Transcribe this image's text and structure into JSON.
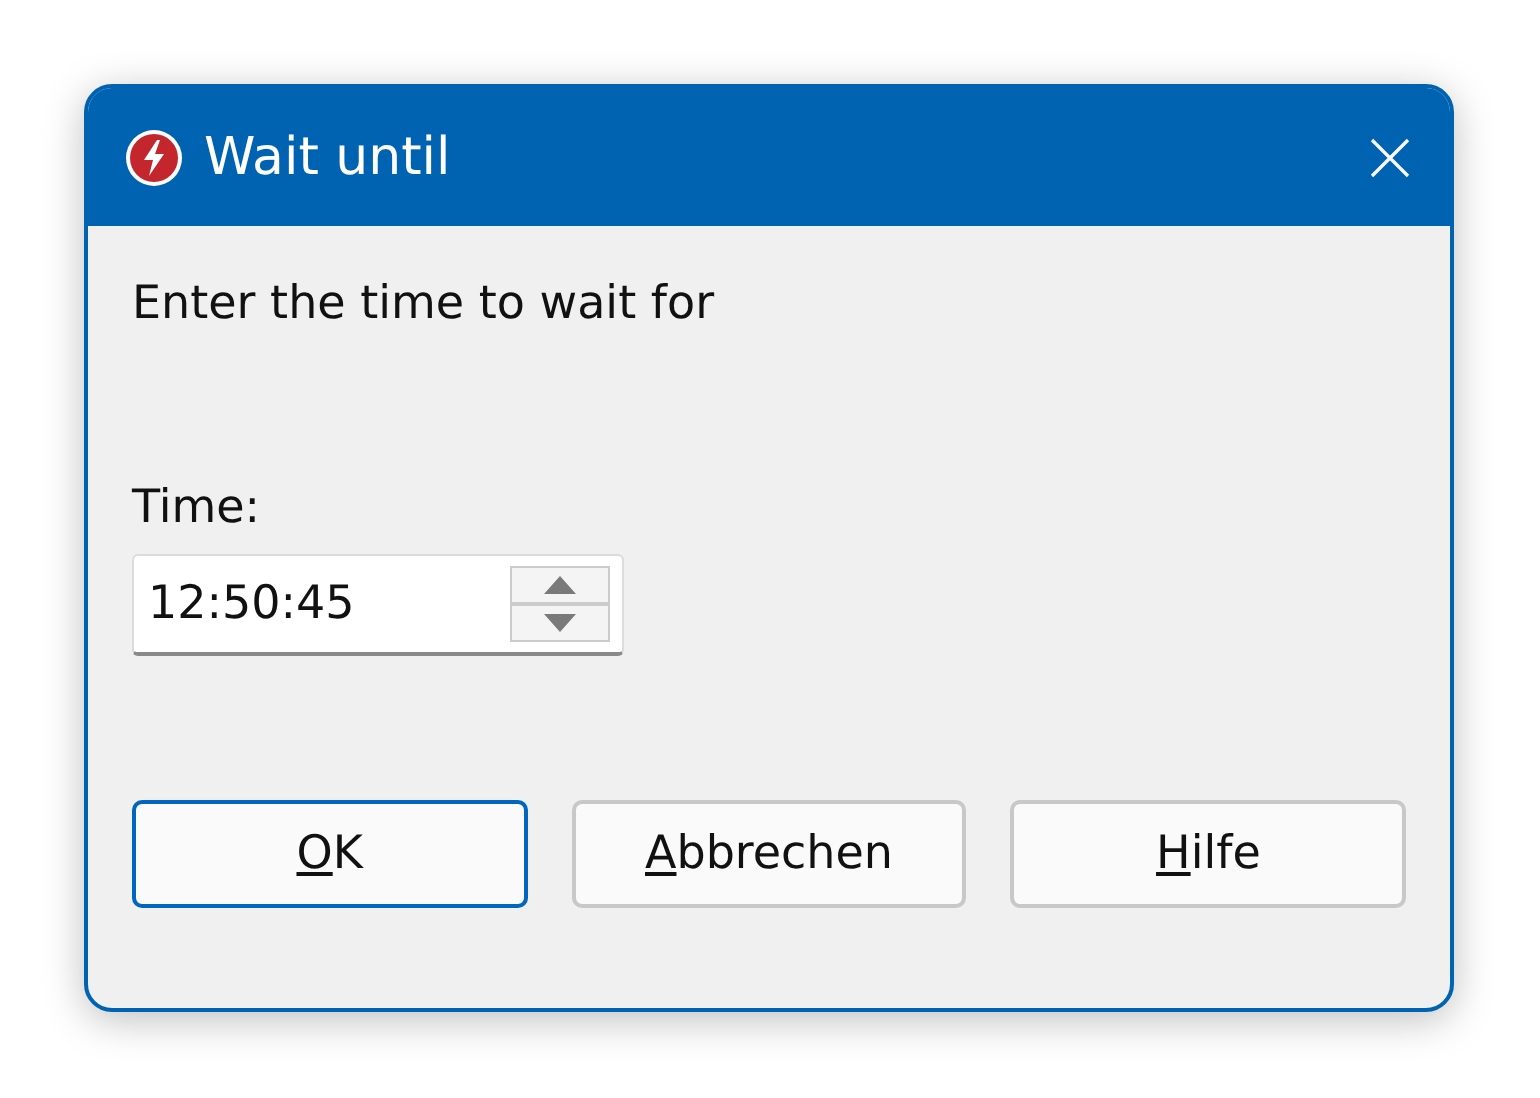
{
  "window": {
    "title": "Wait until"
  },
  "prompt": "Enter the time to wait for",
  "time_field": {
    "label": "Time:",
    "value": "12:50:45"
  },
  "buttons": [
    {
      "mnemonic": "O",
      "rest": "K",
      "default": true
    },
    {
      "mnemonic": "A",
      "rest": "bbrechen",
      "default": false
    },
    {
      "mnemonic": "H",
      "rest": "ilfe",
      "default": false
    }
  ]
}
